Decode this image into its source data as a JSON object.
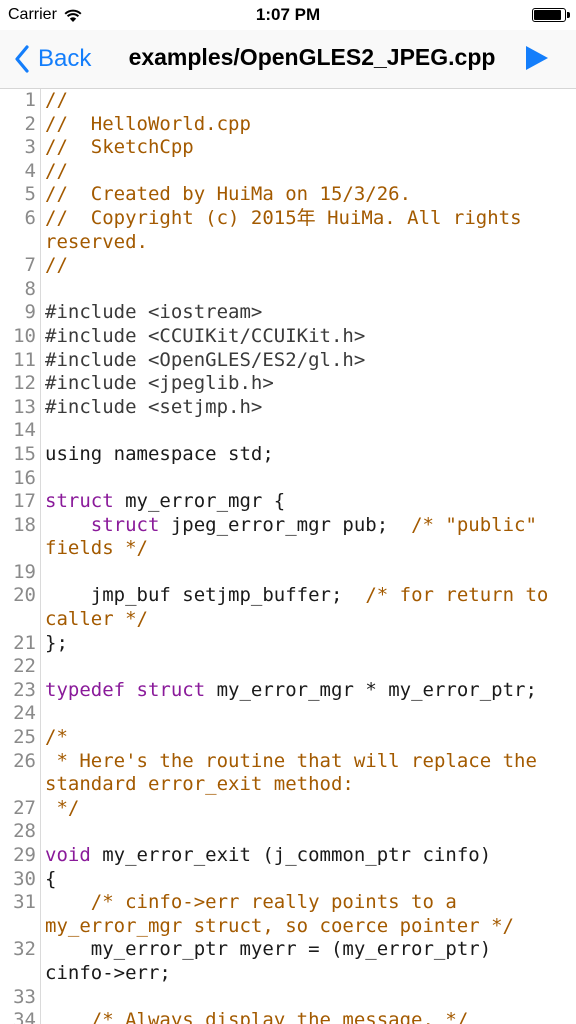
{
  "status_bar": {
    "carrier": "Carrier",
    "time": "1:07 PM",
    "battery_level_percent": 95
  },
  "nav": {
    "back_label": "Back",
    "title": "examples/OpenGLES2_JPEG.cpp"
  },
  "colors": {
    "accent": "#147efb",
    "comment": "#a35a00",
    "keyword": "#8a1a9a"
  },
  "code_lines": [
    {
      "n": "1",
      "segs": [
        {
          "t": "//",
          "c": "cmt"
        }
      ]
    },
    {
      "n": "2",
      "segs": [
        {
          "t": "//  HelloWorld.cpp",
          "c": "cmt"
        }
      ]
    },
    {
      "n": "3",
      "segs": [
        {
          "t": "//  SketchCpp",
          "c": "cmt"
        }
      ]
    },
    {
      "n": "4",
      "segs": [
        {
          "t": "//",
          "c": "cmt"
        }
      ]
    },
    {
      "n": "5",
      "segs": [
        {
          "t": "//  Created by HuiMa on 15/3/26.",
          "c": "cmt"
        }
      ]
    },
    {
      "n": "6",
      "segs": [
        {
          "t": "//  Copyright (c) 2015年 HuiMa. All rights reserved.",
          "c": "cmt"
        }
      ]
    },
    {
      "n": "7",
      "segs": [
        {
          "t": "//",
          "c": "cmt"
        }
      ]
    },
    {
      "n": "8",
      "segs": []
    },
    {
      "n": "9",
      "segs": [
        {
          "t": "#include <iostream>",
          "c": "pp"
        }
      ]
    },
    {
      "n": "10",
      "segs": [
        {
          "t": "#include <CCUIKit/CCUIKit.h>",
          "c": "pp"
        }
      ]
    },
    {
      "n": "11",
      "segs": [
        {
          "t": "#include <OpenGLES/ES2/gl.h>",
          "c": "pp"
        }
      ]
    },
    {
      "n": "12",
      "segs": [
        {
          "t": "#include <jpeglib.h>",
          "c": "pp"
        }
      ]
    },
    {
      "n": "13",
      "segs": [
        {
          "t": "#include <setjmp.h>",
          "c": "pp"
        }
      ]
    },
    {
      "n": "14",
      "segs": []
    },
    {
      "n": "15",
      "segs": [
        {
          "t": "using namespace std;",
          "c": ""
        }
      ]
    },
    {
      "n": "16",
      "segs": []
    },
    {
      "n": "17",
      "segs": [
        {
          "t": "struct",
          "c": "kw"
        },
        {
          "t": " my_error_mgr {",
          "c": ""
        }
      ]
    },
    {
      "n": "18",
      "segs": [
        {
          "t": "    ",
          "c": ""
        },
        {
          "t": "struct",
          "c": "kw"
        },
        {
          "t": " jpeg_error_mgr pub;  ",
          "c": ""
        },
        {
          "t": "/* \"public\" fields */",
          "c": "cmt"
        }
      ]
    },
    {
      "n": "19",
      "segs": []
    },
    {
      "n": "20",
      "segs": [
        {
          "t": "    jmp_buf setjmp_buffer;  ",
          "c": ""
        },
        {
          "t": "/* for return to caller */",
          "c": "cmt"
        }
      ]
    },
    {
      "n": "21",
      "segs": [
        {
          "t": "};",
          "c": ""
        }
      ]
    },
    {
      "n": "22",
      "segs": []
    },
    {
      "n": "23",
      "segs": [
        {
          "t": "typedef",
          "c": "kw"
        },
        {
          "t": " ",
          "c": ""
        },
        {
          "t": "struct",
          "c": "kw"
        },
        {
          "t": " my_error_mgr * my_error_ptr;",
          "c": ""
        }
      ]
    },
    {
      "n": "24",
      "segs": []
    },
    {
      "n": "25",
      "segs": [
        {
          "t": "/*",
          "c": "cmt"
        }
      ]
    },
    {
      "n": "26",
      "segs": [
        {
          "t": " * Here's the routine that will replace the standard error_exit method:",
          "c": "cmt"
        }
      ]
    },
    {
      "n": "27",
      "segs": [
        {
          "t": " */",
          "c": "cmt"
        }
      ]
    },
    {
      "n": "28",
      "segs": []
    },
    {
      "n": "29",
      "segs": [
        {
          "t": "void",
          "c": "kw"
        },
        {
          "t": " my_error_exit (j_common_ptr cinfo)",
          "c": ""
        }
      ]
    },
    {
      "n": "30",
      "segs": [
        {
          "t": "{",
          "c": ""
        }
      ]
    },
    {
      "n": "31",
      "segs": [
        {
          "t": "    ",
          "c": ""
        },
        {
          "t": "/* cinfo->err really points to a my_error_mgr struct, so coerce pointer */",
          "c": "cmt"
        }
      ]
    },
    {
      "n": "32",
      "segs": [
        {
          "t": "    my_error_ptr myerr = (my_error_ptr) cinfo->err;",
          "c": ""
        }
      ]
    },
    {
      "n": "33",
      "segs": []
    },
    {
      "n": "34",
      "segs": [
        {
          "t": "    ",
          "c": ""
        },
        {
          "t": "/* Always display the message. */",
          "c": "cmt"
        }
      ]
    }
  ]
}
